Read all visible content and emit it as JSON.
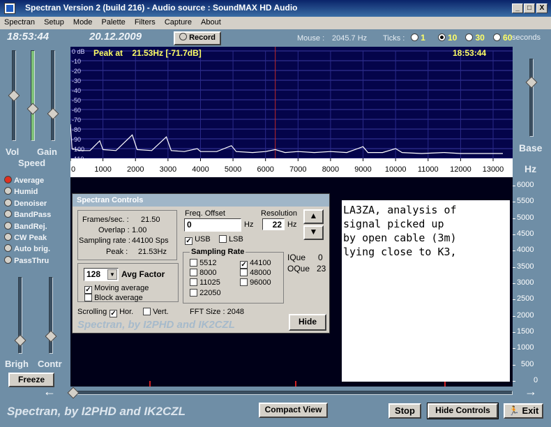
{
  "window": {
    "title": "Spectran Version 2 (build 216) - Audio source : SoundMAX HD Audio",
    "minimize": "_",
    "maximize": "□",
    "close": "X"
  },
  "menu": [
    "Spectran",
    "Setup",
    "Mode",
    "Palette",
    "Filters",
    "Capture",
    "About"
  ],
  "status": {
    "time": "18:53:44",
    "date": "20.12.2009",
    "record_label": "Record",
    "mouse_label": "Mouse :",
    "mouse_value": "2045.7 Hz",
    "ticks_label": "Ticks :",
    "ticks_options": [
      "1",
      "10",
      "30",
      "60"
    ],
    "ticks_selected": "10",
    "ticks_unit": "seconds"
  },
  "left": {
    "vol": "Vol",
    "gain": "Gain",
    "speed": "Speed",
    "brigh": "Brigh",
    "contr": "Contr",
    "freeze": "Freeze",
    "modes": [
      "Average",
      "Humid",
      "Denoiser",
      "BandPass",
      "BandRej.",
      "CW Peak",
      "Auto brig.",
      "PassThru"
    ],
    "mode_selected": "Average"
  },
  "right": {
    "base": "Base",
    "hz": "Hz"
  },
  "chart": {
    "peak_text": "Peak at    21.53Hz [-71.7dB]",
    "time_overlay": "18:53:44"
  },
  "chart_data": {
    "type": "line",
    "title": "",
    "xlabel": "",
    "ylabel": "",
    "xlim": [
      0,
      13300
    ],
    "ylim": [
      -110,
      0
    ],
    "x_ticks": [
      0,
      1000,
      2000,
      3000,
      4000,
      5000,
      6000,
      7000,
      8000,
      9000,
      10000,
      11000,
      12000,
      13000
    ],
    "y_ticks": [
      0,
      -10,
      -20,
      -30,
      -40,
      -50,
      -60,
      -70,
      -80,
      -90,
      -100,
      -110
    ],
    "y_tick_labels": [
      "0 dB",
      "-10",
      "-20",
      "-30",
      "-40",
      "-50",
      "-60",
      "-70",
      "-80",
      "-90",
      "-100",
      "-110"
    ],
    "marker_x": 6300,
    "series": [
      {
        "values": [
          [
            0,
            -75
          ],
          [
            50,
            -100
          ],
          [
            300,
            -102
          ],
          [
            600,
            -102
          ],
          [
            900,
            -92
          ],
          [
            1000,
            -101
          ],
          [
            1400,
            -102
          ],
          [
            1900,
            -86
          ],
          [
            2050,
            -101
          ],
          [
            2500,
            -102
          ],
          [
            2950,
            -88
          ],
          [
            3100,
            -102
          ],
          [
            3500,
            -103
          ],
          [
            3900,
            -100
          ],
          [
            4000,
            -103
          ],
          [
            4500,
            -103
          ],
          [
            4950,
            -97
          ],
          [
            5100,
            -103
          ],
          [
            5600,
            -104
          ],
          [
            6000,
            -103
          ],
          [
            6300,
            -101
          ],
          [
            6600,
            -104
          ],
          [
            7000,
            -103
          ],
          [
            7500,
            -104
          ],
          [
            8000,
            -103
          ],
          [
            8500,
            -104
          ],
          [
            9000,
            -98
          ],
          [
            9150,
            -104
          ],
          [
            9600,
            -104
          ],
          [
            10000,
            -100
          ],
          [
            10200,
            -104
          ],
          [
            10800,
            -105
          ],
          [
            11500,
            -104
          ],
          [
            12000,
            -105
          ],
          [
            12600,
            -105
          ],
          [
            13300,
            -105
          ]
        ]
      }
    ],
    "waterfall_freq_labels": [
      "6000",
      "5500",
      "5000",
      "4500",
      "4000",
      "3500",
      "3000",
      "2500",
      "2000",
      "1500",
      "1000",
      "500",
      "0"
    ]
  },
  "controls": {
    "header": "Spectran Controls",
    "frames_label": "Frames/sec. :",
    "frames_value": "21.50",
    "overlap_label": "Overlap :",
    "overlap_value": "1.00",
    "sampling_label": "Sampling rate :",
    "sampling_value": "44100 Sps",
    "peak_label": "Peak :",
    "peak_value": "21.53Hz",
    "freq_offset_label": "Freq. Offset",
    "freq_offset_value": "0",
    "hz1": "Hz",
    "resolution_label": "Resolution",
    "resolution_value": "22",
    "hz2": "Hz",
    "usb": "USB",
    "lsb": "LSB",
    "sampling_rate_group": "Sampling Rate",
    "rates_left": [
      "5512",
      "8000",
      "11025",
      "22050"
    ],
    "rates_right": [
      "44100",
      "48000",
      "96000"
    ],
    "rate_selected": "44100",
    "iq_label": "IQue",
    "iq_value": "0",
    "oq_label": "OQue",
    "oq_value": "23",
    "avg_value": "128",
    "avg_label": "Avg Factor",
    "moving_avg": "Moving average",
    "block_avg": "Block average",
    "scrolling": "Scrolling",
    "hor": "Hor.",
    "vert": "Vert.",
    "fft_label": "FFT Size : 2048",
    "credit": "Spectran, by I2PHD and IK2CZL",
    "hide": "Hide"
  },
  "notes": "LA3ZA, analysis of\nsignal picked up\nby open cable (3m)\nlying close to K3,",
  "bottom": {
    "credit": "Spectran, by I2PHD and IK2CZL",
    "compact": "Compact View",
    "stop": "Stop",
    "hide_controls": "Hide Controls",
    "exit": "Exit",
    "left_arrow": "←",
    "right_arrow": "→"
  }
}
